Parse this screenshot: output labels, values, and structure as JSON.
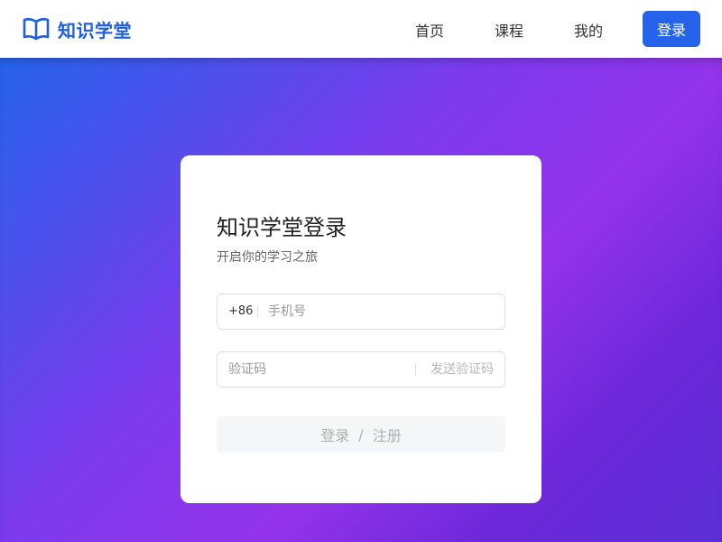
{
  "header": {
    "brand_name": "知识学堂",
    "logo_icon": "book-icon",
    "nav": [
      {
        "label": "首页"
      },
      {
        "label": "课程"
      },
      {
        "label": "我的"
      }
    ],
    "login_label": "登录"
  },
  "login_card": {
    "title": "知识学堂登录",
    "subtitle": "开启你的学习之旅",
    "phone": {
      "prefix": "+86",
      "placeholder": "手机号",
      "value": ""
    },
    "code": {
      "placeholder": "验证码",
      "value": "",
      "send_label": "发送验证码"
    },
    "submit": {
      "login_label": "登录",
      "separator": "/",
      "register_label": "注册"
    }
  },
  "colors": {
    "brand": "#1d5fe0",
    "primary_button": "#2563eb",
    "gradient_start": "#2563eb",
    "gradient_end": "#9333ea"
  }
}
